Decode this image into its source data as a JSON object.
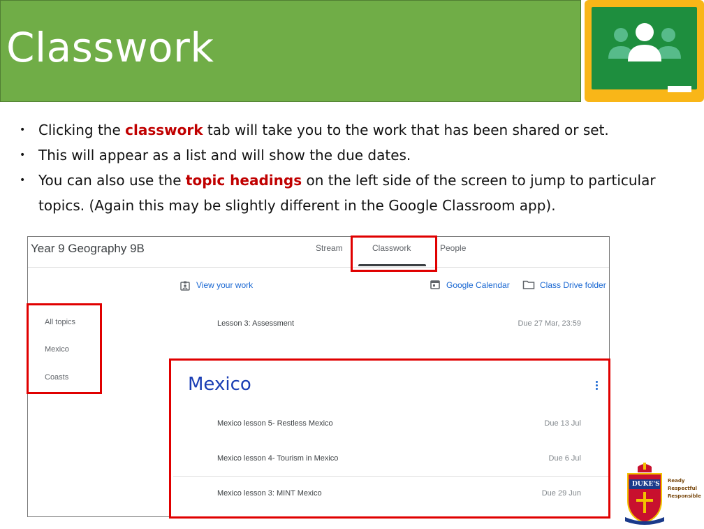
{
  "slide": {
    "title": "Classwork",
    "bullets": [
      {
        "before": "Clicking the ",
        "highlight": "classwork",
        "after": " tab will take you to the work that has been shared or set."
      },
      {
        "before": "This will appear as a list and will show the due dates.",
        "highlight": "",
        "after": ""
      },
      {
        "before": "You can also use the ",
        "highlight": "topic headings",
        "after": " on the left side of the screen to jump to particular topics. (Again this may be slightly different in the Google Classroom app)."
      }
    ],
    "highlight_color": "#c00000",
    "header_color": "#70ad47"
  },
  "classroom": {
    "class_name": "Year 9 Geography 9B",
    "tabs": [
      {
        "label": "Stream",
        "active": false
      },
      {
        "label": "Classwork",
        "active": true
      },
      {
        "label": "People",
        "active": false
      }
    ],
    "toolbar": {
      "view_work": "View your work",
      "calendar": "Google Calendar",
      "drive": "Class Drive folder"
    },
    "topics": [
      "All topics",
      "Mexico",
      "Coasts"
    ],
    "assessment": {
      "title": "Lesson 3: Assessment",
      "due": "Due 27 Mar, 23:59"
    },
    "mexico": {
      "heading": "Mexico",
      "items": [
        {
          "title": "Mexico lesson 5- Restless Mexico",
          "due": "Due 13 Jul"
        },
        {
          "title": "Mexico lesson 4- Tourism in Mexico",
          "due": "Due 6 Jul"
        },
        {
          "title": "Mexico lesson 3: MINT Mexico",
          "due": "Due 29 Jun"
        }
      ]
    },
    "accent_color": "#1967d2"
  },
  "badge": {
    "name": "DUKE'S",
    "values": [
      "Ready",
      "Respectful",
      "Responsible"
    ]
  }
}
